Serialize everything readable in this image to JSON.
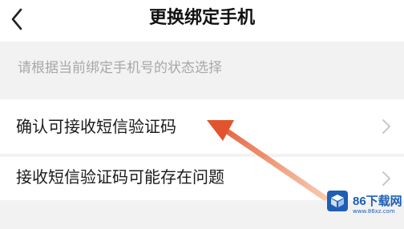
{
  "header": {
    "title": "更换绑定手机",
    "back_icon": "chevron-left-icon"
  },
  "hint": {
    "text": "请根据当前绑定手机号的状态选择"
  },
  "options": [
    {
      "label": "确认可接收短信验证码",
      "icon": "chevron-right-icon"
    },
    {
      "label": "接收短信验证码可能存在问题",
      "icon": "chevron-right-icon"
    }
  ],
  "annotation": {
    "arrow_color": "#e2542e",
    "points_to": "确认可接收短信验证码"
  },
  "watermark": {
    "text": "86下载网",
    "url": "www.86xz.com",
    "accent": "#1e5fb4"
  },
  "colors": {
    "background": "#f2f2f2",
    "card": "#ffffff",
    "hint_text": "#a8a8a8",
    "primary_text": "#1a1a1a"
  }
}
